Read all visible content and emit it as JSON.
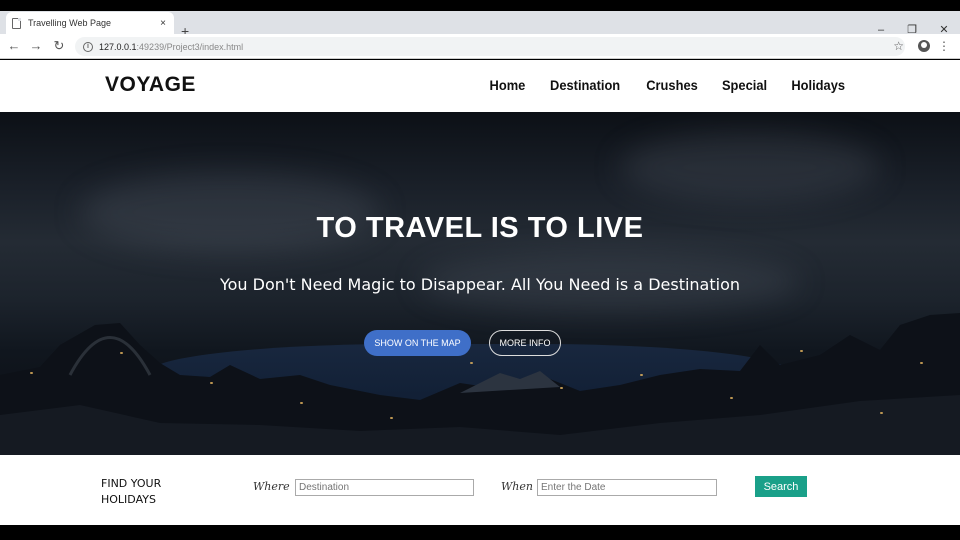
{
  "browser": {
    "tab_title": "Travelling Web Page",
    "tab_close": "×",
    "new_tab": "+",
    "window_controls": [
      "–",
      "❐",
      "✕"
    ],
    "nav": {
      "back": "←",
      "forward": "→",
      "reload": "↻"
    },
    "url_host": "127.0.0.1",
    "url_rest": ":49239/Project3/index.html",
    "star": "☆",
    "menu": "⋮"
  },
  "site": {
    "logo": "VOYAGE",
    "nav": [
      "Home",
      "Destination",
      "Crushes",
      "Special",
      "Holidays"
    ]
  },
  "hero": {
    "title": "TO TRAVEL IS TO LIVE",
    "subtitle": "You Don't Need Magic to Disappear. All You Need is a Destination",
    "buttons": {
      "map": "SHOW ON THE MAP",
      "info": "MORE INFO"
    }
  },
  "search": {
    "heading_line1": "FIND YOUR",
    "heading_line2": "HOLIDAYS",
    "where_label": "Where",
    "where_placeholder": "Destination",
    "when_label": "When",
    "when_placeholder": "Enter the Date",
    "button": "Search"
  },
  "colors": {
    "accent_blue": "#3f6fc8",
    "search_green": "#1aa089"
  }
}
